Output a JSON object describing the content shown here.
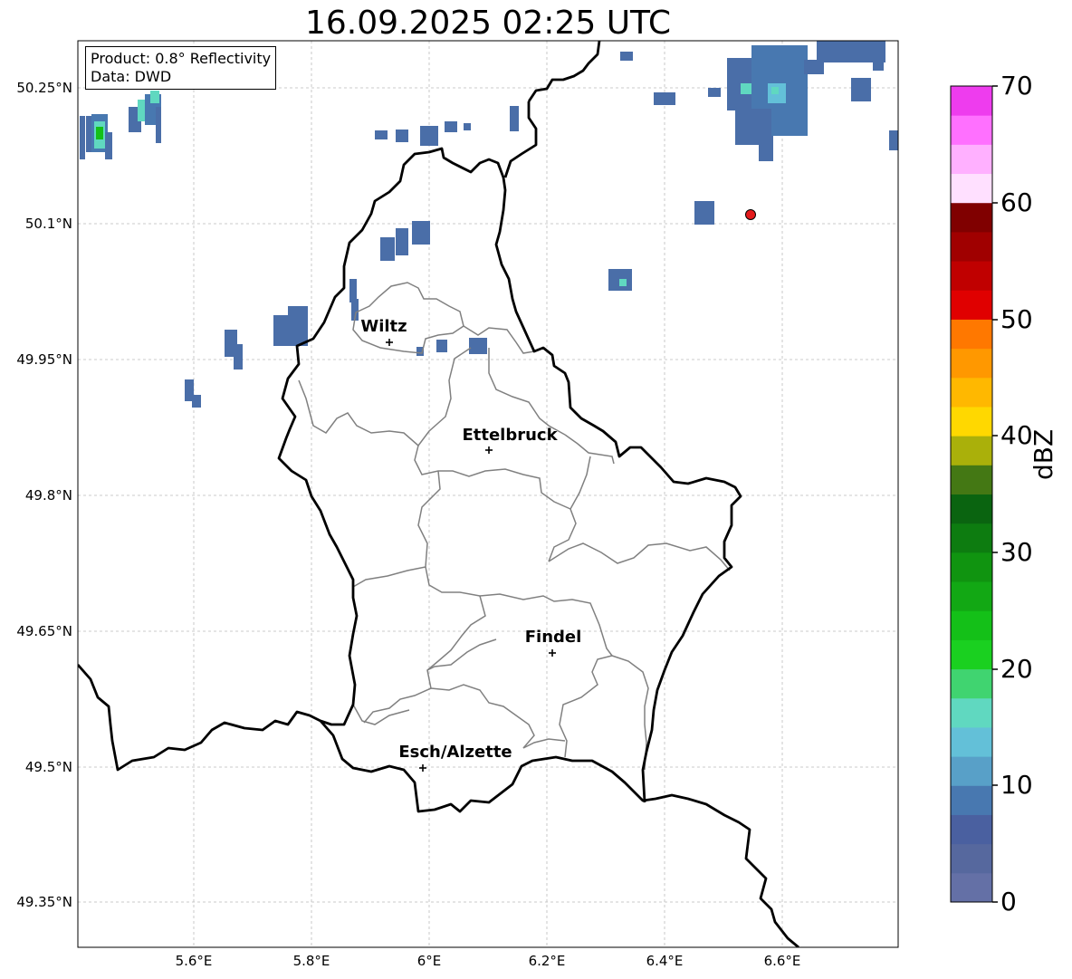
{
  "title": "16.09.2025 02:25 UTC",
  "info_box": {
    "product": "Product: 0.8° Reflectivity",
    "data": "Data: DWD"
  },
  "lat_labels": [
    "50.25°N",
    "50.1°N",
    "49.95°N",
    "49.8°N",
    "49.65°N",
    "49.5°N",
    "49.35°N"
  ],
  "lon_labels": [
    "5.6°E",
    "5.8°E",
    "6°E",
    "6.2°E",
    "6.4°E",
    "6.6°E"
  ],
  "cities": [
    {
      "name": "Wiltz",
      "lon": 5.93,
      "lat": 49.968
    },
    {
      "name": "Ettelbruck",
      "lon": 6.1,
      "lat": 49.848
    },
    {
      "name": "Findel",
      "lon": 6.21,
      "lat": 49.625
    },
    {
      "name": "Esch/Alzette",
      "lon": 5.99,
      "lat": 49.498
    }
  ],
  "marker": {
    "lon": 6.55,
    "lat": 50.11,
    "color": "#e41a1c"
  },
  "colorbar": {
    "unit": "dBZ",
    "ticks": [
      "0",
      "10",
      "20",
      "30",
      "40",
      "50",
      "60",
      "70"
    ],
    "colors": [
      "#6470a6",
      "#56689e",
      "#4a60a0",
      "#4878b0",
      "#58a0c8",
      "#63c0d8",
      "#60d8c0",
      "#40d470",
      "#1ad020",
      "#14c018",
      "#12a814",
      "#109410",
      "#0d7c10",
      "#0a6410",
      "#447814",
      "#aab00a",
      "#ffd800",
      "#ffb800",
      "#ff9800",
      "#ff7800",
      "#e00000",
      "#c00000",
      "#a00000",
      "#800000",
      "#ffe0ff",
      "#ffb0ff",
      "#ff70ff",
      "#ee3cee"
    ]
  },
  "colors": {
    "border": "#000000",
    "admin": "#808080",
    "grid": "#bbbbbb"
  }
}
